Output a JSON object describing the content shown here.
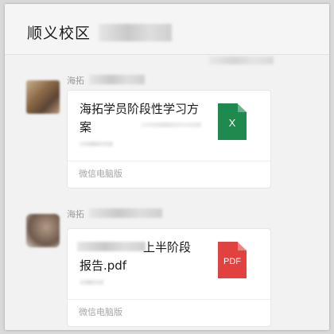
{
  "chat": {
    "title": "顺义校区"
  },
  "messages": [
    {
      "sender": "海拓",
      "file_name": "海拓学员阶段性学习方案",
      "file_icon": "excel-icon",
      "file_icon_label": "X",
      "footer": "微信电脑版"
    },
    {
      "sender": "海拓",
      "file_name": "上半阶段报告.pdf",
      "file_icon": "pdf-icon",
      "file_icon_label": "PDF",
      "footer": "微信电脑版"
    }
  ],
  "colors": {
    "excel": "#1e8a4d",
    "pdf": "#e2423f",
    "background": "#f2f2f2"
  }
}
